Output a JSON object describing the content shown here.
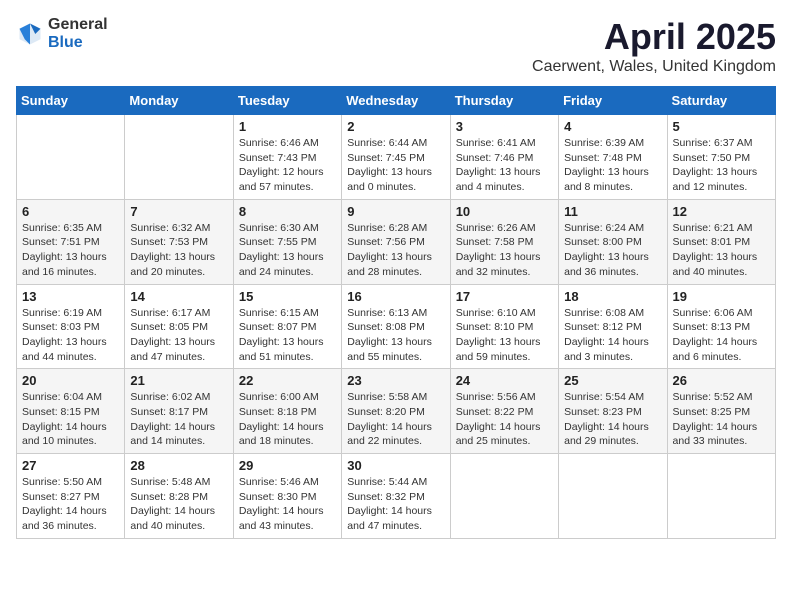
{
  "header": {
    "logo_general": "General",
    "logo_blue": "Blue",
    "month": "April 2025",
    "location": "Caerwent, Wales, United Kingdom"
  },
  "weekdays": [
    "Sunday",
    "Monday",
    "Tuesday",
    "Wednesday",
    "Thursday",
    "Friday",
    "Saturday"
  ],
  "weeks": [
    [
      {
        "day": "",
        "info": ""
      },
      {
        "day": "",
        "info": ""
      },
      {
        "day": "1",
        "info": "Sunrise: 6:46 AM\nSunset: 7:43 PM\nDaylight: 12 hours and 57 minutes."
      },
      {
        "day": "2",
        "info": "Sunrise: 6:44 AM\nSunset: 7:45 PM\nDaylight: 13 hours and 0 minutes."
      },
      {
        "day": "3",
        "info": "Sunrise: 6:41 AM\nSunset: 7:46 PM\nDaylight: 13 hours and 4 minutes."
      },
      {
        "day": "4",
        "info": "Sunrise: 6:39 AM\nSunset: 7:48 PM\nDaylight: 13 hours and 8 minutes."
      },
      {
        "day": "5",
        "info": "Sunrise: 6:37 AM\nSunset: 7:50 PM\nDaylight: 13 hours and 12 minutes."
      }
    ],
    [
      {
        "day": "6",
        "info": "Sunrise: 6:35 AM\nSunset: 7:51 PM\nDaylight: 13 hours and 16 minutes."
      },
      {
        "day": "7",
        "info": "Sunrise: 6:32 AM\nSunset: 7:53 PM\nDaylight: 13 hours and 20 minutes."
      },
      {
        "day": "8",
        "info": "Sunrise: 6:30 AM\nSunset: 7:55 PM\nDaylight: 13 hours and 24 minutes."
      },
      {
        "day": "9",
        "info": "Sunrise: 6:28 AM\nSunset: 7:56 PM\nDaylight: 13 hours and 28 minutes."
      },
      {
        "day": "10",
        "info": "Sunrise: 6:26 AM\nSunset: 7:58 PM\nDaylight: 13 hours and 32 minutes."
      },
      {
        "day": "11",
        "info": "Sunrise: 6:24 AM\nSunset: 8:00 PM\nDaylight: 13 hours and 36 minutes."
      },
      {
        "day": "12",
        "info": "Sunrise: 6:21 AM\nSunset: 8:01 PM\nDaylight: 13 hours and 40 minutes."
      }
    ],
    [
      {
        "day": "13",
        "info": "Sunrise: 6:19 AM\nSunset: 8:03 PM\nDaylight: 13 hours and 44 minutes."
      },
      {
        "day": "14",
        "info": "Sunrise: 6:17 AM\nSunset: 8:05 PM\nDaylight: 13 hours and 47 minutes."
      },
      {
        "day": "15",
        "info": "Sunrise: 6:15 AM\nSunset: 8:07 PM\nDaylight: 13 hours and 51 minutes."
      },
      {
        "day": "16",
        "info": "Sunrise: 6:13 AM\nSunset: 8:08 PM\nDaylight: 13 hours and 55 minutes."
      },
      {
        "day": "17",
        "info": "Sunrise: 6:10 AM\nSunset: 8:10 PM\nDaylight: 13 hours and 59 minutes."
      },
      {
        "day": "18",
        "info": "Sunrise: 6:08 AM\nSunset: 8:12 PM\nDaylight: 14 hours and 3 minutes."
      },
      {
        "day": "19",
        "info": "Sunrise: 6:06 AM\nSunset: 8:13 PM\nDaylight: 14 hours and 6 minutes."
      }
    ],
    [
      {
        "day": "20",
        "info": "Sunrise: 6:04 AM\nSunset: 8:15 PM\nDaylight: 14 hours and 10 minutes."
      },
      {
        "day": "21",
        "info": "Sunrise: 6:02 AM\nSunset: 8:17 PM\nDaylight: 14 hours and 14 minutes."
      },
      {
        "day": "22",
        "info": "Sunrise: 6:00 AM\nSunset: 8:18 PM\nDaylight: 14 hours and 18 minutes."
      },
      {
        "day": "23",
        "info": "Sunrise: 5:58 AM\nSunset: 8:20 PM\nDaylight: 14 hours and 22 minutes."
      },
      {
        "day": "24",
        "info": "Sunrise: 5:56 AM\nSunset: 8:22 PM\nDaylight: 14 hours and 25 minutes."
      },
      {
        "day": "25",
        "info": "Sunrise: 5:54 AM\nSunset: 8:23 PM\nDaylight: 14 hours and 29 minutes."
      },
      {
        "day": "26",
        "info": "Sunrise: 5:52 AM\nSunset: 8:25 PM\nDaylight: 14 hours and 33 minutes."
      }
    ],
    [
      {
        "day": "27",
        "info": "Sunrise: 5:50 AM\nSunset: 8:27 PM\nDaylight: 14 hours and 36 minutes."
      },
      {
        "day": "28",
        "info": "Sunrise: 5:48 AM\nSunset: 8:28 PM\nDaylight: 14 hours and 40 minutes."
      },
      {
        "day": "29",
        "info": "Sunrise: 5:46 AM\nSunset: 8:30 PM\nDaylight: 14 hours and 43 minutes."
      },
      {
        "day": "30",
        "info": "Sunrise: 5:44 AM\nSunset: 8:32 PM\nDaylight: 14 hours and 47 minutes."
      },
      {
        "day": "",
        "info": ""
      },
      {
        "day": "",
        "info": ""
      },
      {
        "day": "",
        "info": ""
      }
    ]
  ]
}
